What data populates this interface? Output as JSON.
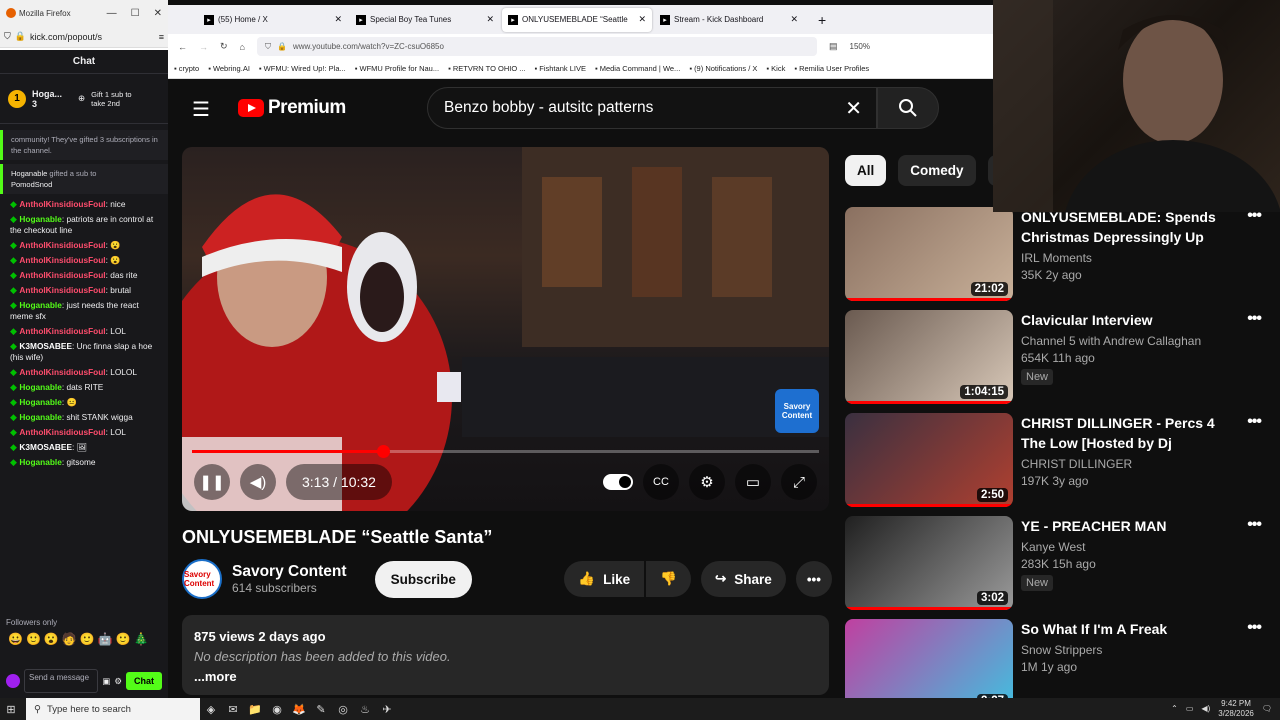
{
  "chat_window": {
    "title": "Mozilla Firefox",
    "url": "kick.com/popout/s",
    "header": "Chat",
    "pinned": {
      "rank": "1",
      "user": "Hoga...",
      "count": "3",
      "gift": "Gift 1 sub to take 2nd"
    },
    "system_top": "community! They've gifted 3 subscriptions in the channel.",
    "system_gift": {
      "user": "Hoganable",
      "text": " gifted a sub to ",
      "target": "PomodSnod"
    },
    "messages": [
      {
        "user": "AntholKinsidiousFoul",
        "color": "#ff4d6d",
        "text": ": nice"
      },
      {
        "user": "Hoganable",
        "color": "#53fc18",
        "text": ": patriots are in control at the checkout line"
      },
      {
        "user": "AntholKinsidiousFoul",
        "color": "#ff4d6d",
        "text": ": 😮"
      },
      {
        "user": "AntholKinsidiousFoul",
        "color": "#ff4d6d",
        "text": ": 😮"
      },
      {
        "user": "AntholKinsidiousFoul",
        "color": "#ff4d6d",
        "text": ": das rite"
      },
      {
        "user": "AntholKinsidiousFoul",
        "color": "#ff4d6d",
        "text": ": brutal"
      },
      {
        "user": "Hoganable",
        "color": "#53fc18",
        "text": ": just needs the react meme sfx"
      },
      {
        "user": "AntholKinsidiousFoul",
        "color": "#ff4d6d",
        "text": ": LOL"
      },
      {
        "user": "K3MOSABEE",
        "color": "#ffffff",
        "text": ": Unc finna slap a hoe (his wife)"
      },
      {
        "user": "AntholKinsidiousFoul",
        "color": "#ff4d6d",
        "text": ": LOLOL"
      },
      {
        "user": "Hoganable",
        "color": "#53fc18",
        "text": ": dats RITE"
      },
      {
        "user": "Hoganable",
        "color": "#53fc18",
        "text": ": 😐"
      },
      {
        "user": "Hoganable",
        "color": "#53fc18",
        "text": ": shit STANK wigga"
      },
      {
        "user": "AntholKinsidiousFoul",
        "color": "#ff4d6d",
        "text": ": LOL"
      },
      {
        "user": "K3MOSABEE",
        "color": "#ffffff",
        "text": ": 🖼"
      },
      {
        "user": "Hoganable",
        "color": "#53fc18",
        "text": ": gitsome"
      }
    ],
    "followers_only": "Followers only",
    "input_placeholder": "Send a message",
    "send_label": "Chat"
  },
  "browser": {
    "tabs": [
      {
        "label": "(55) Home / X",
        "active": false
      },
      {
        "label": "Special Boy Tea Tunes",
        "active": false
      },
      {
        "label": "ONLYUSEMEBLADE “Seattle",
        "active": true
      },
      {
        "label": "Stream - Kick Dashboard",
        "active": false
      }
    ],
    "url": "www.youtube.com/watch?v=ZC-csuO685o",
    "zoom": "150%",
    "bookmarks": [
      "crypto",
      "Webring.AI",
      "WFMU: Wired Up!: Pla...",
      "WFMU Profile for Nau...",
      "RETVRN TO OHIO ...",
      "Fishtank LIVE",
      "Media Command | We...",
      "(9) Notifications / X",
      "Kick",
      "Remilia User Profiles"
    ]
  },
  "youtube": {
    "logo": "Premium",
    "search_query": "Benzo bobby - autsitc patterns",
    "player": {
      "time": "3:13 / 10:32",
      "progress": 0.305,
      "badge": "Savory Content"
    },
    "title": "ONLYUSEMEBLADE “Seattle Santa”",
    "channel": "Savory Content",
    "subscribers": "614 subscribers",
    "subscribe_label": "Subscribe",
    "like_label": "Like",
    "share_label": "Share",
    "avatar_text": "Savory Content",
    "views": "875 views  2 days ago",
    "description": "No description has been added to this video.",
    "more_label": "...more",
    "chips": [
      "All",
      "Comedy",
      "R"
    ],
    "recommendations": [
      {
        "title": "ONLYUSEMEBLADE: Spends Christmas Depressingly Up A ...",
        "channel": "IRL Moments",
        "meta": "35K  2y ago",
        "duration": "21:02",
        "badge": "",
        "progress": 1.0,
        "colors": [
          "#8a7060",
          "#c9b19a"
        ]
      },
      {
        "title": "Clavicular Interview",
        "channel": "Channel 5 with Andrew Callaghan",
        "meta": "654K  11h ago",
        "duration": "1:04:15",
        "badge": "New",
        "progress": 1.0,
        "colors": [
          "#6a5a50",
          "#d8c8b8"
        ]
      },
      {
        "title": "CHRIST DILLINGER - Percs 4 The Low [Hosted by Dj Smoke...",
        "channel": "CHRIST DILLINGER",
        "meta": "197K  3y ago",
        "duration": "2:50",
        "badge": "",
        "progress": 1.0,
        "colors": [
          "#3a3040",
          "#b04030"
        ]
      },
      {
        "title": "YE - PREACHER MAN",
        "channel": "Kanye West",
        "meta": "283K  15h ago",
        "duration": "3:02",
        "badge": "New",
        "progress": 1.0,
        "colors": [
          "#202020",
          "#9a9a9a"
        ]
      },
      {
        "title": "So What If I'm A Freak",
        "channel": "Snow Strippers",
        "meta": "1M  1y ago",
        "duration": "2:27",
        "badge": "",
        "progress": 0.0,
        "colors": [
          "#c040a0",
          "#40c0e0"
        ]
      }
    ]
  },
  "taskbar": {
    "search_placeholder": "Type here to search",
    "time": "9:42 PM",
    "date": "3/28/2026"
  }
}
